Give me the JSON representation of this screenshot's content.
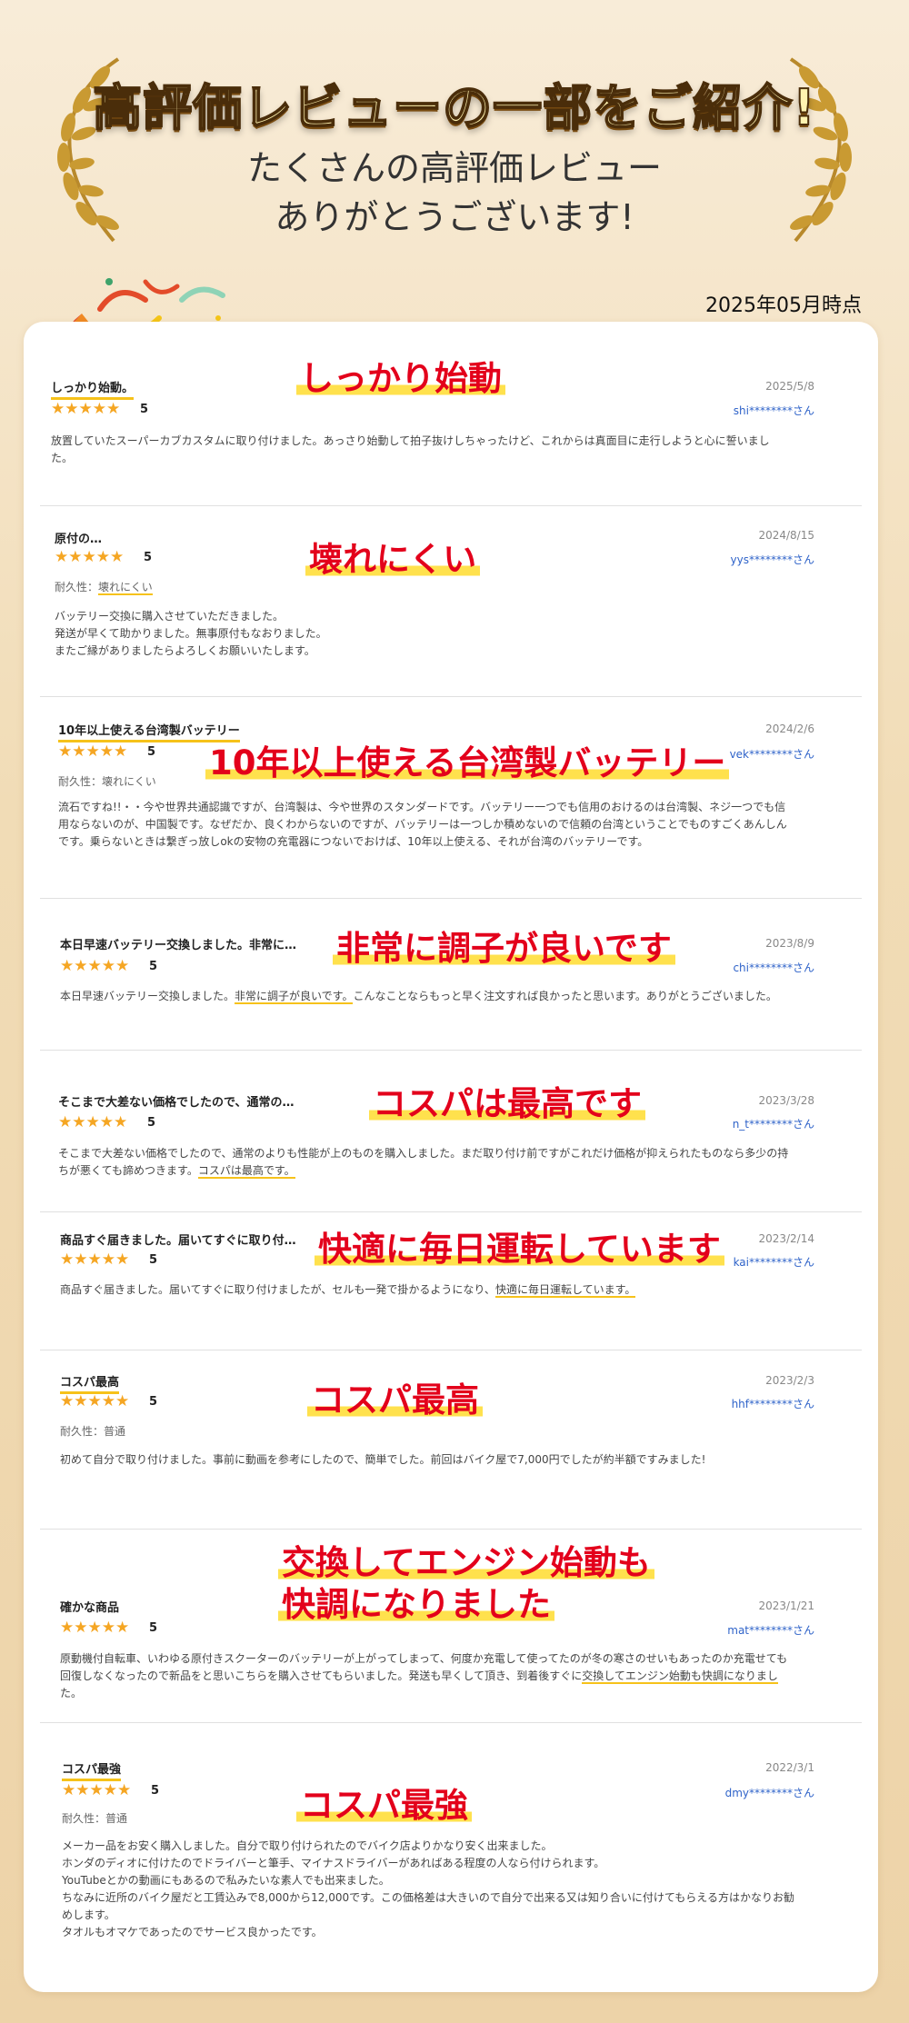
{
  "header": {
    "title": "高評価レビューの一部をご紹介!",
    "subtitle_line1": "たくさんの高評価レビュー",
    "subtitle_line2": "ありがとうございます!",
    "as_of": "2025年05月時点"
  },
  "reviews": [
    {
      "title": "しっかり始動。",
      "stars": "★★★★★",
      "score": "5",
      "date": "2025/5/8",
      "user": "shi********さん",
      "body": "放置していたスーパーカブカスタムに取り付けました。あっさり始動して拍子抜けしちゃったけど、これからは真面目に走行しようと心に誓いまし\nた。",
      "callout": "しっかり始動"
    },
    {
      "title": "原付の…",
      "stars": "★★★★★",
      "score": "5",
      "date": "2024/8/15",
      "user": "yys********さん",
      "durability_label": "耐久性：",
      "durability": "壊れにくい",
      "body": "バッテリー交換に購入させていただきました。\n発送が早くて助かりました。無事原付もなおりました。\nまたご縁がありましたらよろしくお願いいたします。",
      "callout": "壊れにくい"
    },
    {
      "title": "10年以上使える台湾製バッテリー",
      "stars": "★★★★★",
      "score": "5",
      "date": "2024/2/6",
      "user": "vek********さん",
      "durability_label": "耐久性：",
      "durability": "壊れにくい",
      "body": "流石ですね!!・・今や世界共通認識ですが、台湾製は、今や世界のスタンダードです。バッテリー一つでも信用のおけるのは台湾製、ネジ一つでも信\n用ならないのが、中国製です。なぜだか、良くわからないのですが、バッテリーは一つしか積めないので信頼の台湾ということでものすごくあんしん\nです。乗らないときは繋ぎっ放しokの安物の充電器につないでおけば、10年以上使える、それが台湾のバッテリーです。",
      "callout": "10年以上使える台湾製バッテリー"
    },
    {
      "title": "本日早速バッテリー交換しました。非常に…",
      "stars": "★★★★★",
      "score": "5",
      "date": "2023/8/9",
      "user": "chi********さん",
      "body_pre": "本日早速バッテリー交換しました。",
      "body_hl": "非常に調子が良いです。",
      "body_post": "こんなことならもっと早く注文すれば良かったと思います。ありがとうございました。",
      "callout": "非常に調子が良いです"
    },
    {
      "title": "そこまで大差ない価格でしたので、通常の…",
      "stars": "★★★★★",
      "score": "5",
      "date": "2023/3/28",
      "user": "n_t********さん",
      "body_pre": "そこまで大差ない価格でしたので、通常のよりも性能が上のものを購入しました。まだ取り付け前ですがこれだけ価格が抑えられたものなら多少の持\nちが悪くても諦めつきます。",
      "body_hl": "コスパは最高です。",
      "body_post": "",
      "callout": "コスパは最高です"
    },
    {
      "title": "商品すぐ届きました。届いてすぐに取り付…",
      "stars": "★★★★★",
      "score": "5",
      "date": "2023/2/14",
      "user": "kai********さん",
      "body_pre": "商品すぐ届きました。届いてすぐに取り付けましたが、セルも一発で掛かるようになり、",
      "body_hl": "快適に毎日運転しています。",
      "body_post": "",
      "callout": "快適に毎日運転しています"
    },
    {
      "title": "コスパ最高",
      "stars": "★★★★★",
      "score": "5",
      "date": "2023/2/3",
      "user": "hhf********さん",
      "durability_label": "耐久性：",
      "durability": "普通",
      "body": "初めて自分で取り付けました。事前に動画を参考にしたので、簡単でした。前回はバイク屋で7,000円でしたが約半額ですみました!",
      "callout": "コスパ最高"
    },
    {
      "title": "確かな商品",
      "stars": "★★★★★",
      "score": "5",
      "date": "2023/1/21",
      "user": "mat********さん",
      "body_pre": "原動機付自転車、いわゆる原付きスクーターのバッテリーが上がってしまって、何度か充電して使ってたのが冬の寒さのせいもあったのか充電せても\n回復しなくなったので新品をと思いこちらを購入させてもらいました。発送も早くして頂き、到着後すぐに",
      "body_hl": "交換してエンジン始動も快調になりまし",
      "body_post": "\nた。",
      "callout_line1": "交換してエンジン始動も",
      "callout_line2": "快調になりました"
    },
    {
      "title": "コスパ最強",
      "stars": "★★★★★",
      "score": "5",
      "date": "2022/3/1",
      "user": "dmy********さん",
      "durability_label": "耐久性：",
      "durability": "普通",
      "body": "メーカー品をお安く購入しました。自分で取り付けられたのでバイク店よりかなり安く出来ました。\nホンダのディオに付けたのでドライバーと筆手、マイナスドライバーがあればある程度の人なら付けられます。\nYouTubeとかの動画にもあるので私みたいな素人でも出来ました。\nちなみに近所のバイク屋だと工賃込みで8,000から12,000です。この価格差は大きいので自分で出来る又は知り合いに付けてもらえる方はかなりお勧\nめします。\nタオルもオマケであったのでサービス良かったです。",
      "callout": "コスパ最強"
    }
  ],
  "colors": {
    "callout_text": "#e3001b",
    "marker": "#ffe14d",
    "star": "#f5a623",
    "user_link": "#2f63c9"
  },
  "icons": {
    "laurel": "laurel-wreath-icon",
    "party": "party-popper-icon"
  }
}
